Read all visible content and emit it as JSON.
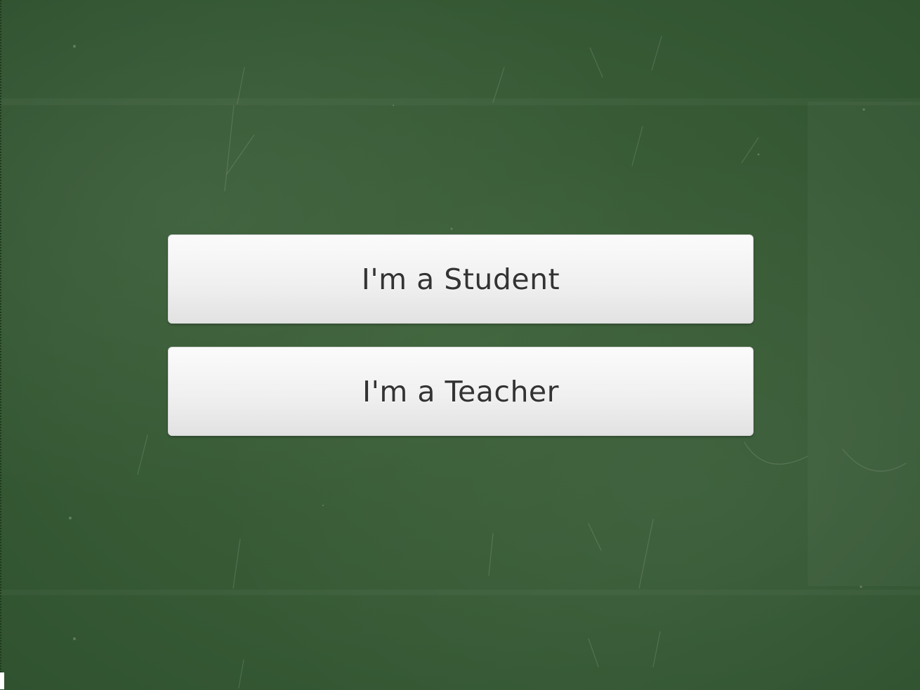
{
  "page": {
    "background_color": "#3a5e38"
  },
  "buttons": {
    "student_label": "I'm a Student",
    "teacher_label": "I'm a Teacher"
  },
  "colors": {
    "button_background": "#f0f0f0",
    "button_text": "#333333"
  }
}
